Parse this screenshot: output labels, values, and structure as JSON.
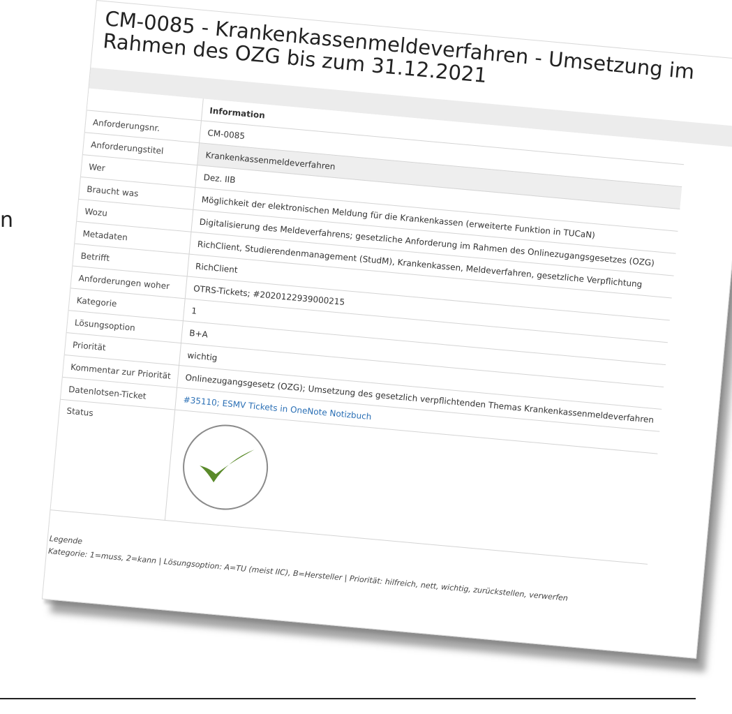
{
  "stray_text": "n",
  "page_title": "CM-0085 - Krankenkassenmeldeverfahren - Umsetzung im Rahmen des OZG bis zum 31.12.2021",
  "table": {
    "header": "Information",
    "rows": [
      {
        "label": "Anforderungsnr.",
        "value": "CM-0085"
      },
      {
        "label": "Anforderungstitel",
        "value": "Krankenkassenmeldeverfahren"
      },
      {
        "label": "Wer",
        "value": "Dez. IIB"
      },
      {
        "label": "Braucht was",
        "value": "Möglichkeit der elektronischen Meldung für die Krankenkassen (erweiterte Funktion in TUCaN)"
      },
      {
        "label": "Wozu",
        "value": "Digitalisierung des Meldeverfahrens; gesetzliche Anforderung im Rahmen des Onlinezugangsgesetzes (OZG)"
      },
      {
        "label": "Metadaten",
        "value": "RichClient, Studierendenmanagement (StudM), Krankenkassen, Meldeverfahren, gesetzliche Verpflichtung"
      },
      {
        "label": "Betrifft",
        "value": "RichClient"
      },
      {
        "label": "Anforderungen woher",
        "value": "OTRS-Tickets; #2020122939000215"
      },
      {
        "label": "Kategorie",
        "value": "1"
      },
      {
        "label": "Lösungsoption",
        "value": "B+A"
      },
      {
        "label": "Priorität",
        "value": "wichtig"
      },
      {
        "label": "Kommentar zur Priorität",
        "value": "Onlinezugangsgesetz (OZG); Umsetzung des gesetzlich verpflichtenden Themas Krankenkassenmeldeverfahren"
      },
      {
        "label": "Datenlotsen-Ticket",
        "value": "#35110; ESMV Tickets in OneNote Notizbuch"
      },
      {
        "label": "Status",
        "value": ""
      }
    ]
  },
  "status_icon": "checkmark-icon",
  "colors": {
    "link": "#2a6fb5",
    "check": "#5a8a2a",
    "shade": "#eeeeee"
  },
  "legend": {
    "title": "Legende",
    "text": "Kategorie: 1=muss, 2=kann | Lösungsoption: A=TU (meist IIC), B=Hersteller | Priorität: hilfreich, nett, wichtig, zurückstellen, verwerfen"
  }
}
